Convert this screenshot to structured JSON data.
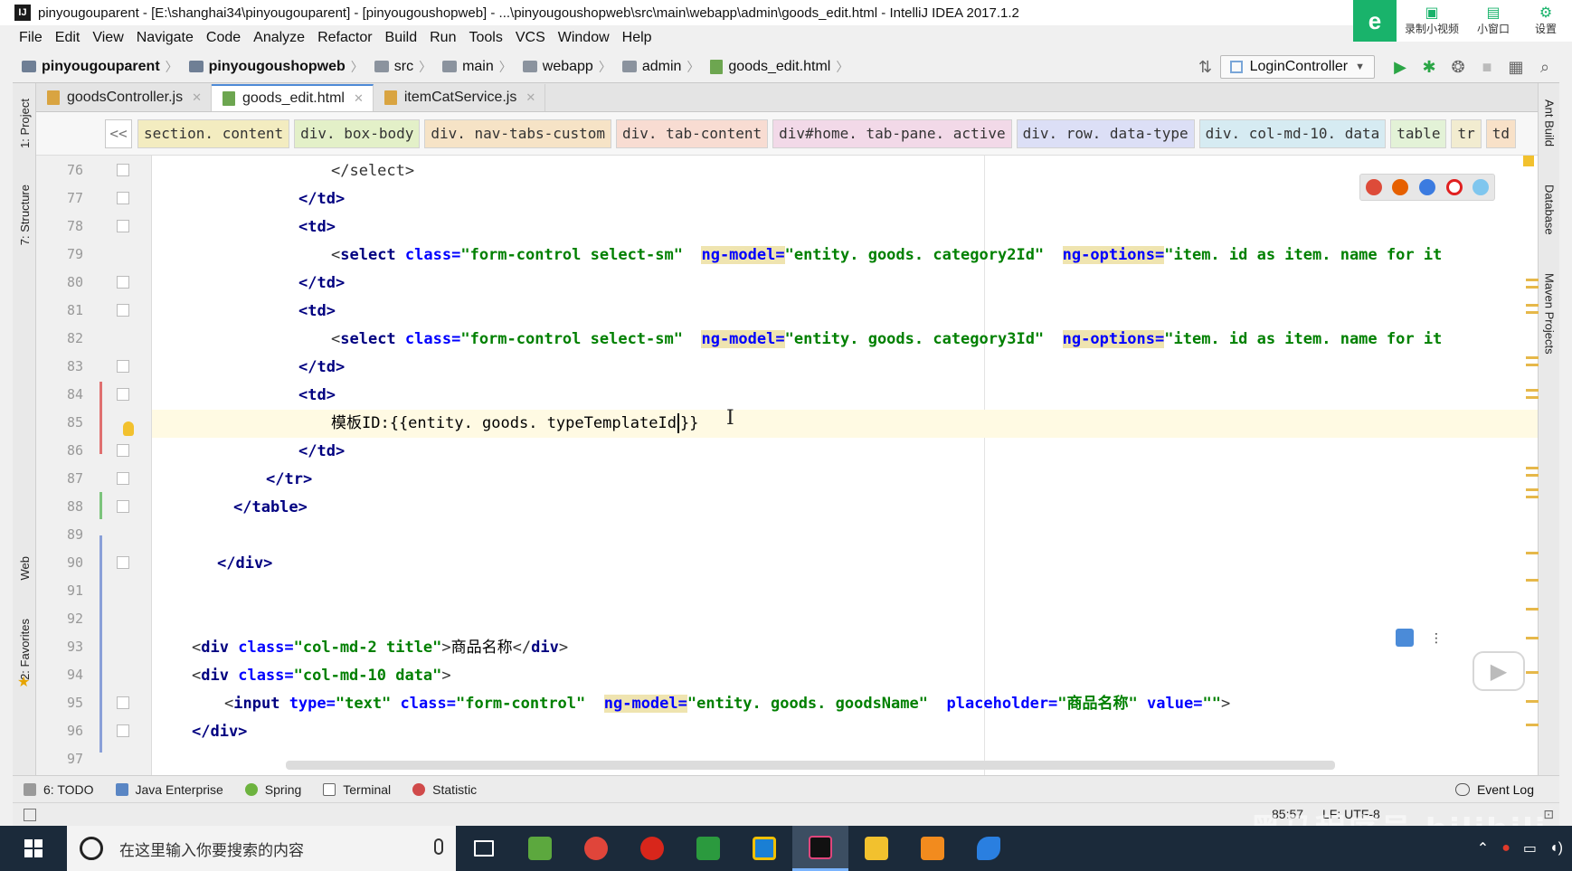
{
  "window": {
    "title": "pinyougouparent - [E:\\shanghai34\\pinyougouparent] - [pinyougoushopweb] - ...\\pinyougoushopweb\\src\\main\\webapp\\admin\\goods_edit.html - IntelliJ IDEA 2017.1.2",
    "app_icon_text": "IJ"
  },
  "recorder": {
    "logo": "e",
    "record_label": "录制小视频",
    "mini_label": "小窗口",
    "settings_label": "设置"
  },
  "menu": [
    "File",
    "Edit",
    "View",
    "Navigate",
    "Code",
    "Analyze",
    "Refactor",
    "Build",
    "Run",
    "Tools",
    "VCS",
    "Window",
    "Help"
  ],
  "nav": {
    "crumbs": [
      "pinyougouparent",
      "pinyougoushopweb",
      "src",
      "main",
      "webapp",
      "admin",
      "goods_edit.html"
    ],
    "run_config": "LoginController"
  },
  "left_tools": [
    "1: Project",
    "7: Structure",
    "Web",
    "2: Favorites"
  ],
  "right_tools": [
    "Ant Build",
    "Database",
    "Maven Projects"
  ],
  "tabs": [
    {
      "label": "goodsController.js",
      "type": "js"
    },
    {
      "label": "goods_edit.html",
      "type": "html"
    },
    {
      "label": "itemCatService.js",
      "type": "js"
    }
  ],
  "tagpath": {
    "back": "<<",
    "items": [
      "section. content",
      "div. box-body",
      "div. nav-tabs-custom",
      "div. tab-content",
      "div#home. tab-pane. active",
      "div. row. data-type",
      "div. col-md-10. data",
      "table",
      "tr",
      "td"
    ],
    "colors": [
      "#f3ecc0",
      "#e3f0c8",
      "#f6e3c6",
      "#f8dcd2",
      "#f2d9e8",
      "#dcdff6",
      "#d6ebf2",
      "#e3f2d7",
      "#f2ecd0",
      "#f8e1c8"
    ]
  },
  "line_numbers": [
    "76",
    "77",
    "78",
    "79",
    "80",
    "81",
    "82",
    "83",
    "84",
    "85",
    "86",
    "87",
    "88",
    "89",
    "90",
    "91",
    "92",
    "93",
    "94",
    "95",
    "96",
    "97"
  ],
  "code": {
    "l76": "</select>",
    "l77": "</td>",
    "l78": "<td>",
    "l79": {
      "tag": "select",
      "attr1": "class=",
      "val1": "\"form-control select-sm\"",
      "attr2": "ng-model=",
      "val2": "\"entity. goods. category2Id\"",
      "attr3": "ng-options=",
      "val3": "\"item. id as item. name for it"
    },
    "l80": "</td>",
    "l81": "<td>",
    "l82": {
      "tag": "select",
      "attr1": "class=",
      "val1": "\"form-control select-sm\"",
      "attr2": "ng-model=",
      "val2": "\"entity. goods. category3Id\"",
      "attr3": "ng-options=",
      "val3": "\"item. id as item. name for it"
    },
    "l83": "</td>",
    "l84": "<td>",
    "l85_before": "模板ID:{{entity. goods. typeTemplateId",
    "l85_after": "}}",
    "l86": "</td>",
    "l87": "</tr>",
    "l88": "</table>",
    "l90": "</div>",
    "l93": {
      "tag": "div",
      "attr": "class=",
      "val": "\"col-md-2 title\"",
      "text": "商品名称",
      "close": "div"
    },
    "l94": {
      "tag": "div",
      "attr": "class=",
      "val": "\"col-md-10 data\""
    },
    "l95": {
      "tag": "input",
      "attr1": "type=",
      "val1": "\"text\"",
      "attr2": "class=",
      "val2": "\"form-control\"",
      "attr3": "ng-model=",
      "val3": "\"entity. goods. goodsName\"",
      "attr4": "placeholder=",
      "val4": "\"商品名称\"",
      "attr5": "value=",
      "val5": "\"\""
    },
    "l96": "</div>"
  },
  "bottom_tabs": [
    "6: TODO",
    "Java Enterprise",
    "Spring",
    "Terminal",
    "Statistic"
  ],
  "event_log": "Event Log",
  "status": {
    "position": "85:57",
    "line_sep": "LF:",
    "encoding": "UTF-8"
  },
  "watermark": "黑马程序员 bilibili",
  "taskbar": {
    "search_placeholder": "在这里输入你要搜索的内容"
  }
}
